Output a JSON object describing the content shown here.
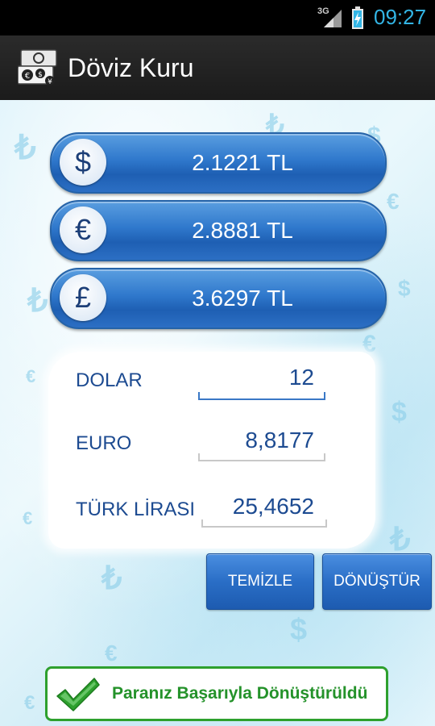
{
  "status_bar": {
    "network": "3G",
    "time": "09:27"
  },
  "app": {
    "title": "Döviz Kuru",
    "icon": "currency-exchange-icon"
  },
  "rates": [
    {
      "currency_icon": "dollar-icon",
      "symbol": "$",
      "value": "2.1221 TL"
    },
    {
      "currency_icon": "euro-icon",
      "symbol": "€",
      "value": "2.8881 TL"
    },
    {
      "currency_icon": "pound-icon",
      "symbol": "£",
      "value": "3.6297 TL"
    }
  ],
  "converter": {
    "rows": [
      {
        "label": "DOLAR",
        "value": "12"
      },
      {
        "label": "EURO",
        "value": "8,8177"
      },
      {
        "label": "TÜRK LİRASI",
        "value": "25,4652"
      }
    ]
  },
  "buttons": {
    "clear": "TEMİZLE",
    "convert": "DÖNÜŞTÜR"
  },
  "toast": {
    "message": "Paranız Başarıyla Dönüştürüldü",
    "icon": "checkmark-icon"
  },
  "colors": {
    "accent": "#2f78cc",
    "label": "#1d4b91",
    "success": "#2ea02e",
    "clock": "#33b5e5"
  }
}
